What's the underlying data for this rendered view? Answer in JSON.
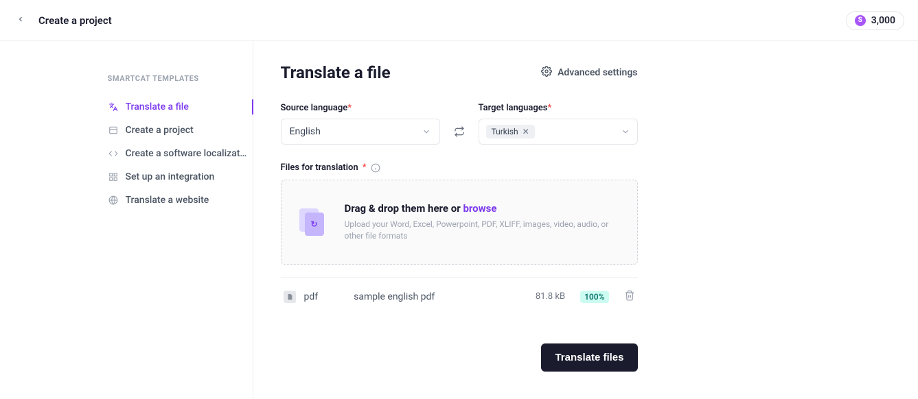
{
  "header": {
    "title": "Create a project",
    "credits": "3,000",
    "credits_badge": "S"
  },
  "sidebar": {
    "heading": "SMARTCAT TEMPLATES",
    "items": [
      {
        "label": "Translate a file"
      },
      {
        "label": "Create a project"
      },
      {
        "label": "Create a software localizatio…"
      },
      {
        "label": "Set up an integration"
      },
      {
        "label": "Translate a website"
      }
    ]
  },
  "main": {
    "title": "Translate a file",
    "advanced": "Advanced settings",
    "source_label": "Source language",
    "source_value": "English",
    "target_label": "Target languages",
    "target_chip": "Turkish",
    "files_label": "Files for translation",
    "dz_title_prefix": "Drag & drop them here or ",
    "dz_browse": "browse",
    "dz_sub": "Upload your Word, Excel, Powerpoint, PDF, XLIFF, images, video, audio, or other file formats",
    "file": {
      "ext": "pdf",
      "name": "sample english pdf",
      "size": "81.8 kB",
      "pct": "100%"
    },
    "submit": "Translate files"
  }
}
